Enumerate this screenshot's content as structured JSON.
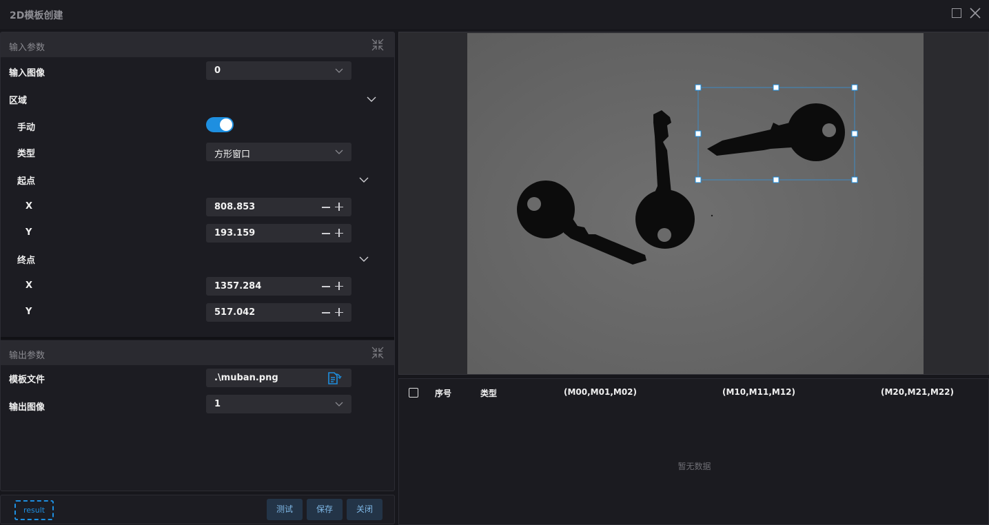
{
  "window": {
    "title": "2D模板创建"
  },
  "input_section": {
    "header": "输入参数",
    "input_image": {
      "label": "输入图像",
      "value": "0"
    },
    "region": {
      "label": "区域",
      "manual": {
        "label": "手动",
        "on": true
      },
      "type": {
        "label": "类型",
        "value": "方形窗口"
      },
      "start": {
        "label": "起点",
        "x_label": "X",
        "x_value": "808.853",
        "y_label": "Y",
        "y_value": "193.159"
      },
      "end": {
        "label": "终点",
        "x_label": "X",
        "x_value": "1357.284",
        "y_label": "Y",
        "y_value": "517.042"
      }
    }
  },
  "output_section": {
    "header": "输出参数",
    "template_file": {
      "label": "模板文件",
      "value": ".\\muban.png"
    },
    "output_image": {
      "label": "输出图像",
      "value": "1"
    }
  },
  "footer": {
    "result_label": "result",
    "test_button": "测试",
    "save_button": "保存",
    "close_button": "关闭"
  },
  "table": {
    "columns": [
      "序号",
      "类型",
      "(M00,M01,M02)",
      "(M10,M11,M12)",
      "(M20,M21,M22)"
    ],
    "empty_text": "暂无数据"
  },
  "colors": {
    "accent": "#1e8fe0",
    "background": "#17171c",
    "panel": "#1c1c22"
  },
  "icons": [
    "maximize-icon",
    "close-icon",
    "collapse-icon",
    "chevron-down-icon",
    "minus-icon",
    "plus-icon",
    "file-icon"
  ]
}
